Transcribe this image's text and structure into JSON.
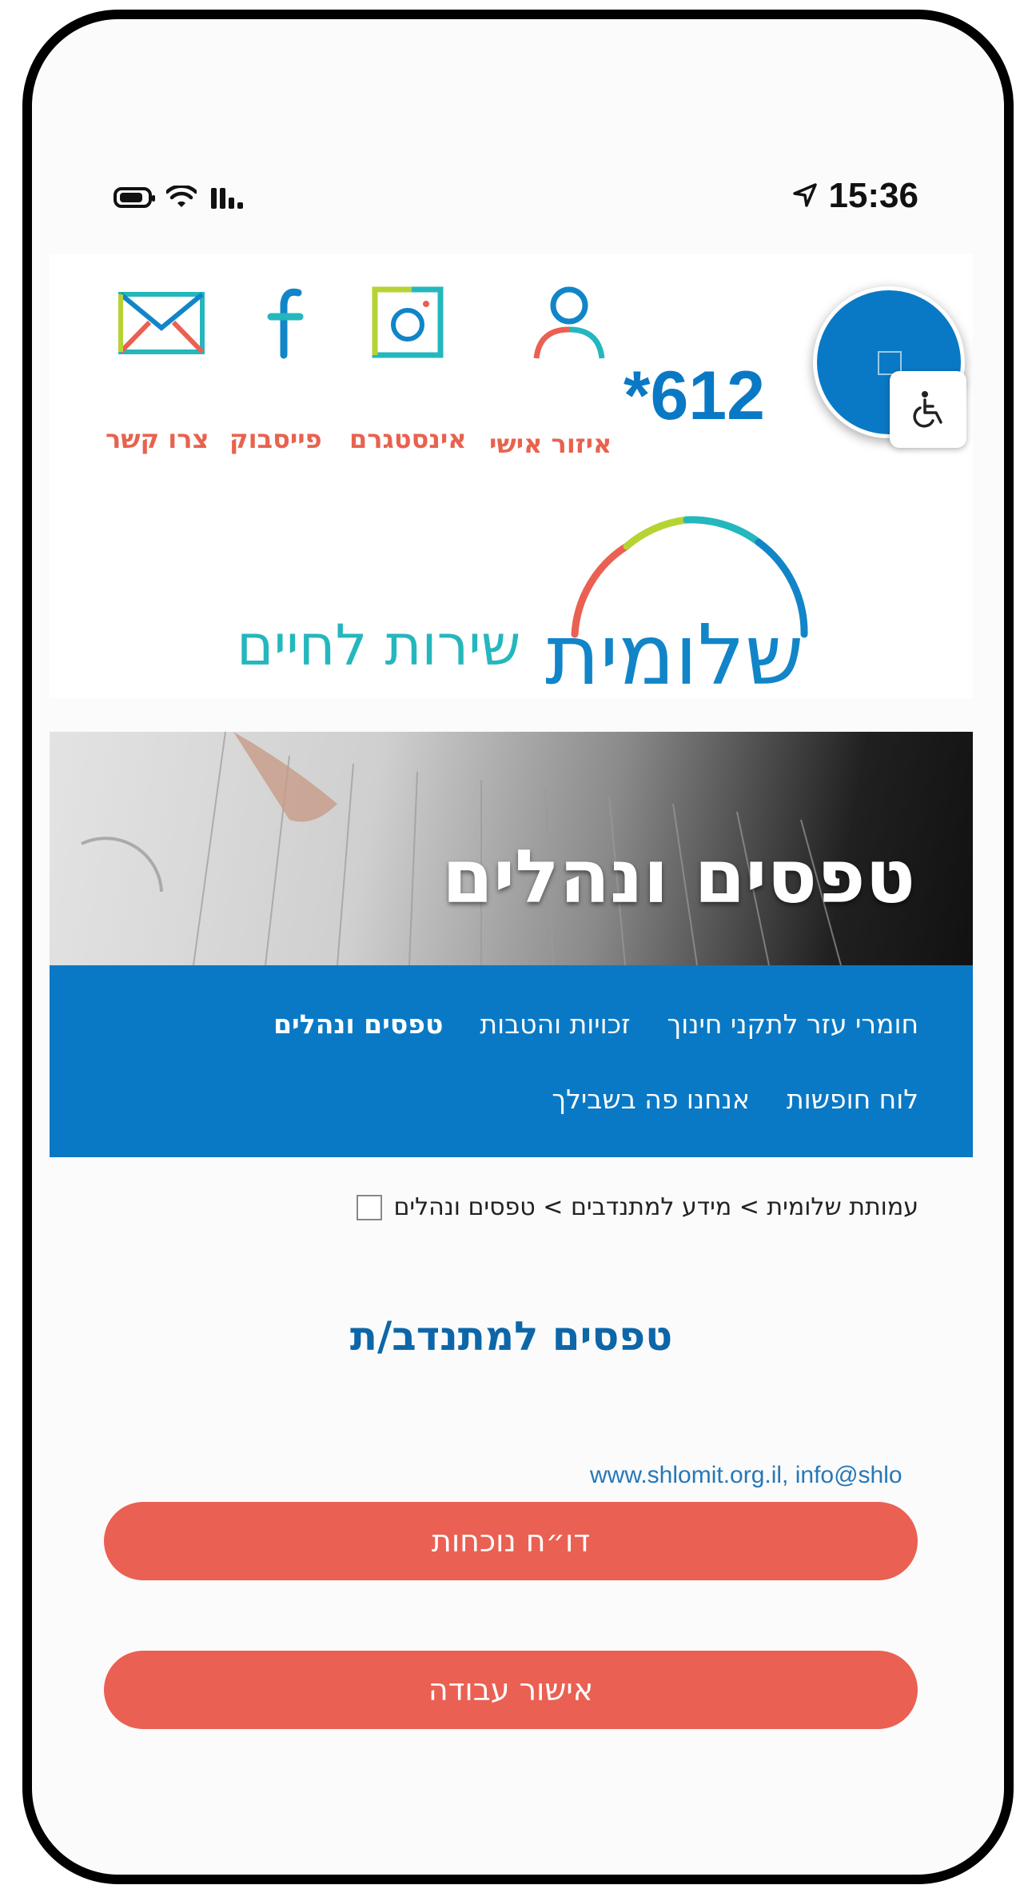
{
  "status_bar": {
    "time": "15:36"
  },
  "header": {
    "phone_number": "*612",
    "links": [
      {
        "label": "צרו קשר",
        "icon": "mail-icon"
      },
      {
        "label": "פייסבוק",
        "icon": "facebook-icon"
      },
      {
        "label": "אינסטגרם",
        "icon": "instagram-icon"
      },
      {
        "label": "איזור אישי",
        "icon": "user-icon"
      }
    ]
  },
  "logo": {
    "word": "שלומית",
    "tagline": "שירות לחיים"
  },
  "hero": {
    "title": "טפסים ונהלים"
  },
  "nav": {
    "row1": [
      "טפסים ונהלים",
      "זכויות והטבות",
      "חומרי עזר לתקני חינוך"
    ],
    "row2": [
      "אנחנו פה בשבילך",
      "לוח חופשות"
    ],
    "active": "טפסים ונהלים"
  },
  "breadcrumb": {
    "text": "עמותת שלומית > מידע למתנדבים > טפסים ונהלים"
  },
  "page": {
    "heading": "טפסים למתנדב/ת",
    "doc_link_text": "www.shlomit.org.il, info@shlo"
  },
  "buttons": {
    "attendance": "דו״ח נוכחות",
    "work_cert": "אישור עבודה"
  },
  "colors": {
    "primary_blue": "#0a79c5",
    "accent_red": "#ea6052",
    "teal": "#24b7bd",
    "heading_blue": "#0d66a8"
  }
}
